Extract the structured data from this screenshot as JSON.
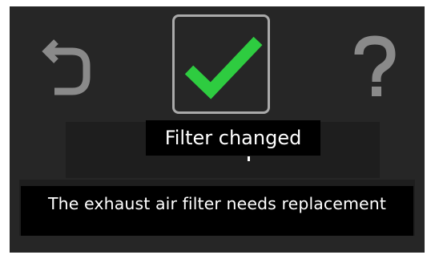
{
  "screen": {
    "background": "#262626",
    "accent_check": "#2ecc40",
    "icon_gray": "#8a8a8a"
  },
  "toolbar": {
    "back_icon": "back-arrow-icon",
    "confirm_icon": "checkmark-icon",
    "help_icon": "question-mark-icon"
  },
  "status": {
    "title": "Filter changed"
  },
  "message": {
    "text": "The exhaust air filter needs replacement"
  }
}
